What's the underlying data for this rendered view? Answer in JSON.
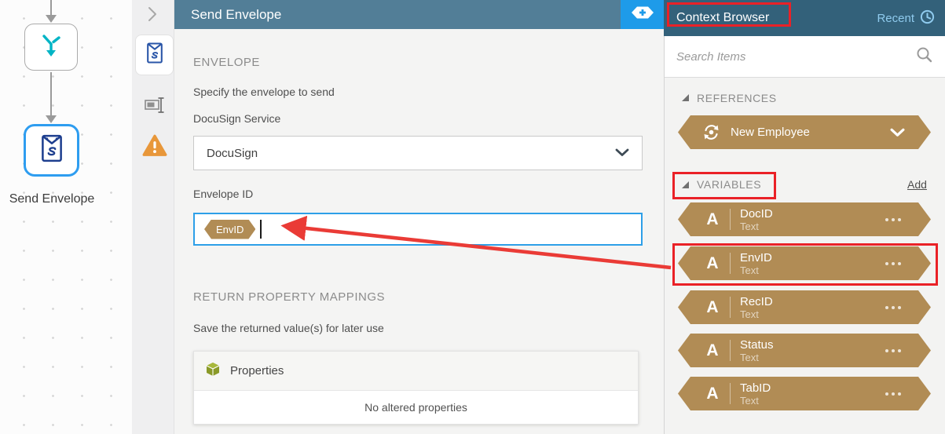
{
  "canvas": {
    "node_label": "Send Envelope"
  },
  "panel": {
    "title": "Send Envelope",
    "envelope_section": {
      "heading": "ENVELOPE",
      "description": "Specify the envelope to send",
      "service_label": "DocuSign Service",
      "service_value": "DocuSign",
      "envelope_id_label": "Envelope ID",
      "envelope_id_token": "EnvID"
    },
    "return_section": {
      "heading": "RETURN PROPERTY MAPPINGS",
      "description": "Save the returned value(s) for later use",
      "properties_label": "Properties",
      "empty_message": "No altered properties"
    }
  },
  "context_browser": {
    "title": "Context Browser",
    "recent_label": "Recent",
    "search": {
      "placeholder": "Search Items"
    },
    "references": {
      "heading": "REFERENCES",
      "items": [
        {
          "label": "New Employee"
        }
      ]
    },
    "variables": {
      "heading": "VARIABLES",
      "add_label": "Add",
      "items": [
        {
          "name": "DocID",
          "type": "Text"
        },
        {
          "name": "EnvID",
          "type": "Text"
        },
        {
          "name": "RecID",
          "type": "Text"
        },
        {
          "name": "Status",
          "type": "Text"
        },
        {
          "name": "TabID",
          "type": "Text"
        }
      ]
    }
  },
  "icons": {
    "header_add": "token-plus-icon",
    "recent": "clock-icon",
    "search": "search-icon",
    "reference": "smartobject-refresh-icon",
    "variable": "text-variable-icon",
    "warning": "warning-triangle-icon",
    "properties": "cube-icon"
  },
  "colors": {
    "panel_header_blue": "#527e97",
    "context_header_blue": "#33617a",
    "accent_blue": "#1e9be9",
    "focus_blue": "#2d9fe8",
    "token_gold": "#b18c55",
    "annotation_red": "#ea2127",
    "warning_orange": "#e8973a",
    "properties_olive": "#8a9a28"
  }
}
